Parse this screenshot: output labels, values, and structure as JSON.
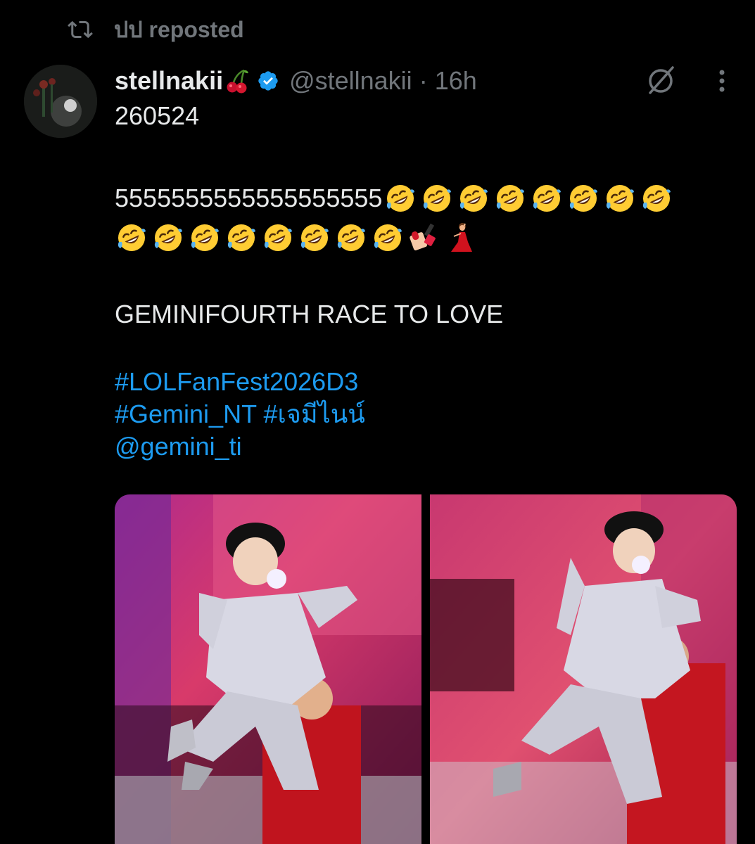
{
  "repost": {
    "icon": "repost-icon",
    "text": "ปป reposted"
  },
  "tweet": {
    "avatar": "avatar",
    "display_name": "stellnakii",
    "name_emoji": "cherries-emoji",
    "verified_icon": "verified-badge-icon",
    "handle": "@stellnakii",
    "separator": "·",
    "time": "16h",
    "grok_icon": "grok-icon",
    "more_icon": "more-vertical-icon",
    "lines": {
      "date": "260524",
      "laugh_number": "5555555555555555555",
      "title": "GEMINIFOURTH RACE TO LOVE",
      "hashtag_1": "#LOLFanFest2026D3",
      "hashtag_2": "#Gemini_NT",
      "hashtag_3": "#เจมีไนน์",
      "mention": "@gemini_ti"
    },
    "emojis_row1": [
      "rofl",
      "rofl",
      "rofl",
      "rofl",
      "rofl",
      "rofl",
      "rofl",
      "rofl"
    ],
    "emojis_row2": [
      "rofl",
      "rofl",
      "rofl",
      "rofl",
      "rofl",
      "rofl",
      "rofl",
      "rofl",
      "nail-polish",
      "dancer"
    ],
    "media": [
      "performer-jumping-photo-1",
      "performer-jumping-photo-2"
    ]
  },
  "colors": {
    "background": "#000000",
    "text": "#e7e9ea",
    "muted": "#71767b",
    "link": "#1d9bf0",
    "verified": "#1d9bf0"
  }
}
